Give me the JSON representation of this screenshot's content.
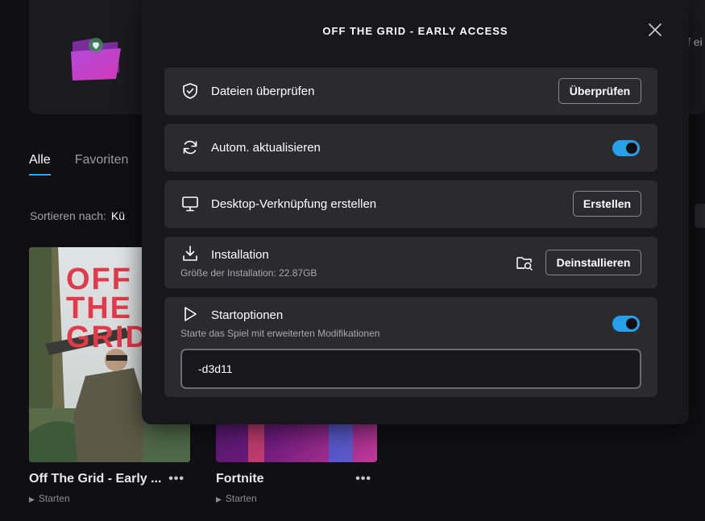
{
  "background": {
    "banner_cut_text": "f ei",
    "tabs": [
      {
        "label": "Alle"
      },
      {
        "label": "Favoriten"
      }
    ],
    "sort_label": "Sortieren nach:",
    "sort_value": "Kü",
    "games": [
      {
        "title": "Off The Grid - Early ...",
        "action": "Starten",
        "art_text": [
          "OFF",
          "THE",
          "GRID"
        ]
      },
      {
        "title": "Fortnite",
        "action": "Starten"
      }
    ],
    "more_glyph": "•••",
    "play_glyph": "▶"
  },
  "modal": {
    "title": "OFF THE GRID - EARLY ACCESS",
    "close_icon": "close-icon",
    "rows": {
      "verify": {
        "icon": "shield-check-icon",
        "label": "Dateien überprüfen",
        "button": "Überprüfen"
      },
      "auto_update": {
        "icon": "sync-icon",
        "label": "Autom. aktualisieren",
        "enabled": true
      },
      "shortcut": {
        "icon": "monitor-icon",
        "label": "Desktop-Verknüpfung erstellen",
        "button": "Erstellen"
      },
      "installation": {
        "icon": "download-icon",
        "label": "Installation",
        "sub": "Größe der Installation: 22.87GB",
        "button": "Deinstallieren",
        "folder_icon": "folder-search-icon"
      },
      "launch_options": {
        "icon": "play-icon",
        "label": "Startoptionen",
        "sub": "Starte das Spiel mit erweiterten Modifikationen",
        "enabled": true,
        "value": "-d3d11"
      }
    }
  },
  "colors": {
    "accent": "#26a0e8",
    "modal_bg": "#18181c",
    "row_bg": "#2a2a2f",
    "page_bg": "#101014"
  }
}
